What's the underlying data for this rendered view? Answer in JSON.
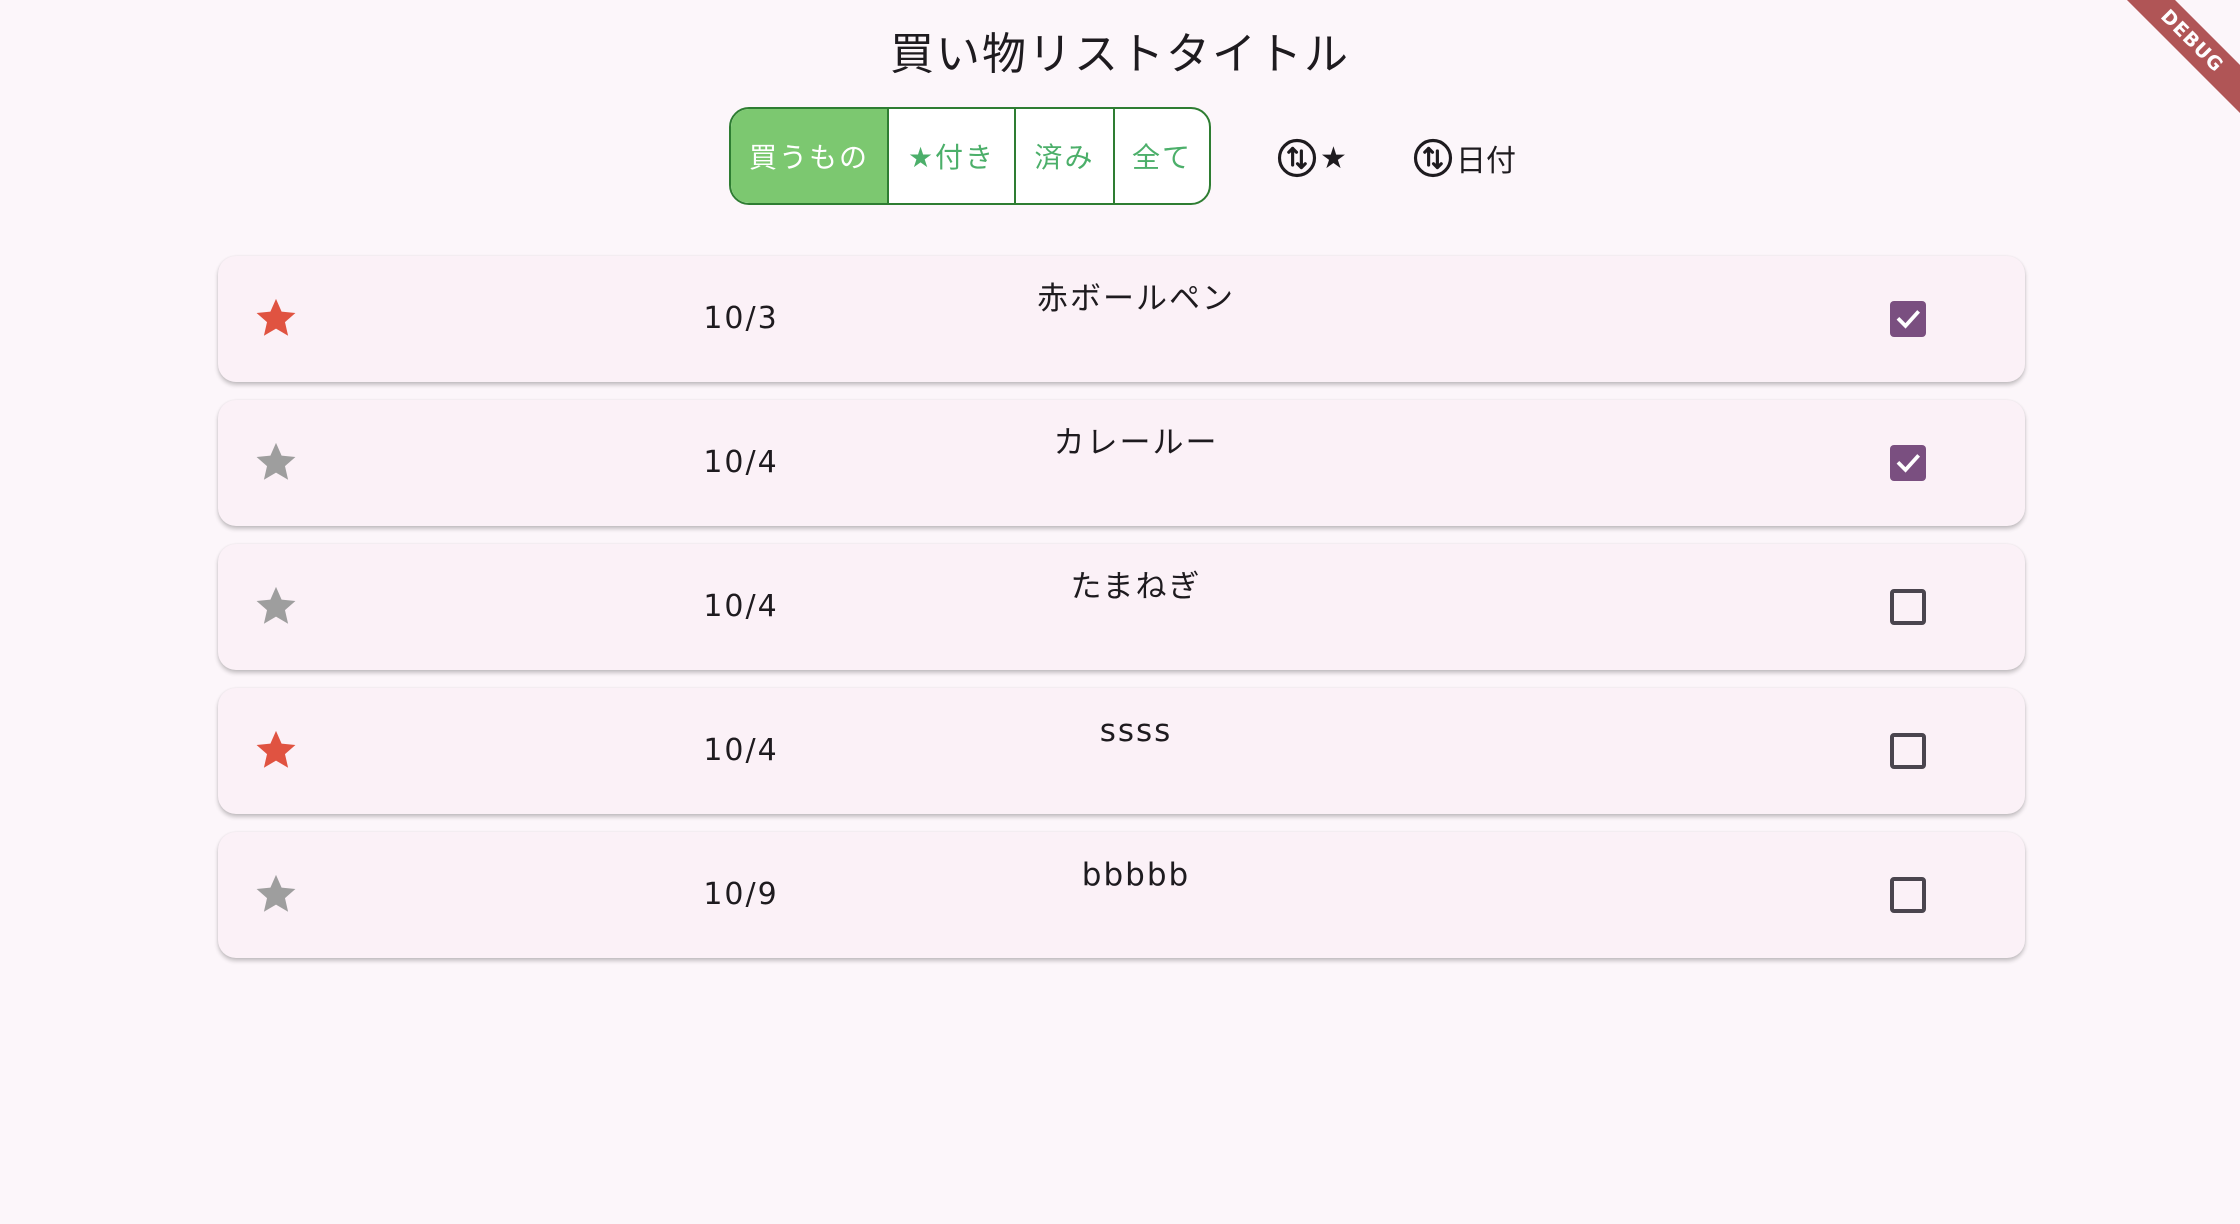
{
  "app": {
    "title": "買い物リストタイトル",
    "debug_banner": "DEBUG"
  },
  "filters": {
    "selected": 0,
    "segments": [
      {
        "label": "買うもの"
      },
      {
        "label": "★付き"
      },
      {
        "label": "済み"
      },
      {
        "label": "全て"
      }
    ]
  },
  "sort": {
    "star_label": "★",
    "date_label": "日付"
  },
  "colors": {
    "star_on": "#e05341",
    "star_off": "#9e9e9e",
    "checkbox_checked": "#7a4f80",
    "segment_active": "#7cc870",
    "segment_border": "#2e7d32"
  },
  "items": [
    {
      "starred": true,
      "date": "10/3",
      "name": "赤ボールペン",
      "checked": true
    },
    {
      "starred": false,
      "date": "10/4",
      "name": "カレールー",
      "checked": true
    },
    {
      "starred": false,
      "date": "10/4",
      "name": "たまねぎ",
      "checked": false
    },
    {
      "starred": true,
      "date": "10/4",
      "name": "ssss",
      "checked": false
    },
    {
      "starred": false,
      "date": "10/9",
      "name": "bbbbb",
      "checked": false
    }
  ]
}
